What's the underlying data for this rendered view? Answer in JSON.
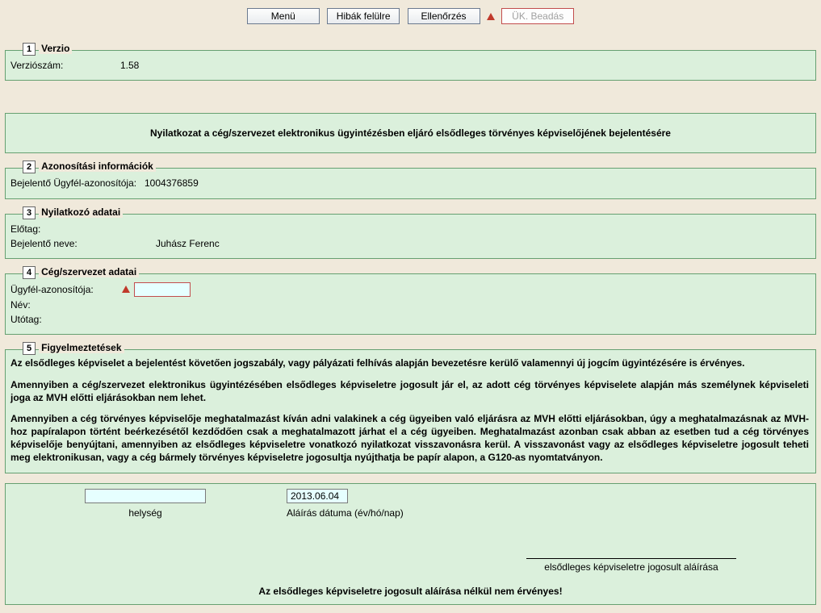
{
  "buttons": {
    "menu": "Menü",
    "errors_up": "Hibák felülre",
    "check": "Ellenőrzés",
    "submit": "ÜK. Beadás"
  },
  "sections": {
    "s1": {
      "num": "1",
      "title": "Verzio"
    },
    "s2": {
      "num": "2",
      "title": "Azonosítási információk"
    },
    "s3": {
      "num": "3",
      "title": "Nyilatkozó adatai"
    },
    "s4": {
      "num": "4",
      "title": "Cég/szervezet adatai"
    },
    "s5": {
      "num": "5",
      "title": "Figyelmeztetések"
    }
  },
  "version": {
    "label": "Verziószám:",
    "value": "1.58"
  },
  "declaration_title": "Nyilatkozat a cég/szervezet elektronikus ügyintézésben eljáró elsődleges törvényes képviselőjének bejelentésére",
  "ident": {
    "label": "Bejelentő Ügyfél-azonosítója:",
    "value": "1004376859"
  },
  "declarant": {
    "prefix_label": "Előtag:",
    "name_label": "Bejelentő neve:",
    "name_value": "Juhász Ferenc"
  },
  "org": {
    "id_label": "Ügyfél-azonosítója:",
    "id_value": "",
    "name_label": "Név:",
    "suffix_label": "Utótag:"
  },
  "warnings": {
    "p1": "Az elsődleges képviselet a bejelentést követően jogszabály, vagy pályázati felhívás alapján bevezetésre kerülő valamennyi új jogcím ügyintézésére is érvényes.",
    "p2": "Amennyiben a cég/szervezet elektronikus ügyintézésében elsődleges képviseletre jogosult jár el, az adott cég törvényes képviselete alapján más személynek képviseleti joga az MVH előtti eljárásokban nem lehet.",
    "p3": "Amennyiben a cég törvényes képviselője meghatalmazást kíván adni valakinek a cég ügyeiben való eljárásra az MVH előtti eljárásokban, úgy a meghatalmazásnak az MVH-hoz papíralapon történt beérkezésétől kezdődően csak a meghatalmazott járhat el a cég ügyeiben. Meghatalmazást azonban csak abban az esetben tud a cég törvényes képviselője benyújtani, amennyiben az elsődleges képviseletre vonatkozó nyilatkozat visszavonásra kerül. A visszavonást vagy az elsődleges képviseletre jogosult teheti meg elektronikusan, vagy a cég bármely törvényes képviseletre jogosultja nyújthatja be papír alapon, a G120-as nyomtatványon."
  },
  "signing": {
    "place_value": "",
    "place_label": "helység",
    "date_value": "2013.06.04",
    "date_label": "Aláírás dátuma (év/hó/nap)",
    "sig_caption": "elsődleges képviseletre jogosult aláírása",
    "bottom": "Az elsődleges képviseletre jogosult aláírása nélkül nem    érvényes!"
  }
}
